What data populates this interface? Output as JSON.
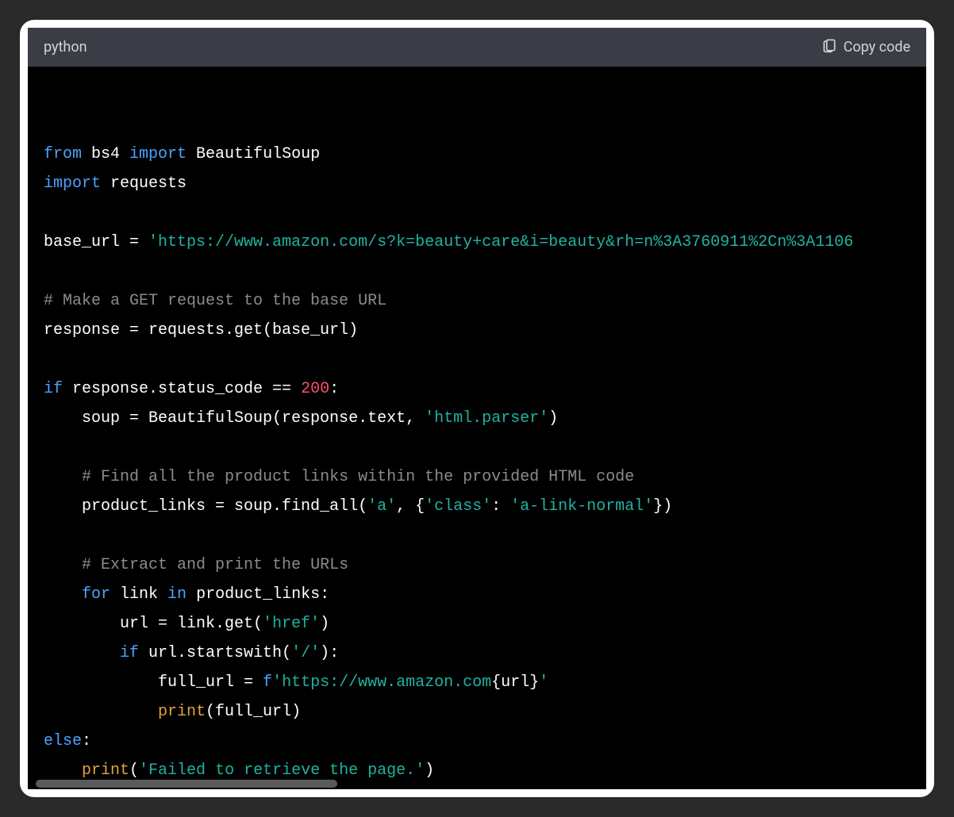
{
  "header": {
    "language": "python",
    "copy_label": "Copy code"
  },
  "code": {
    "tokens": [
      [
        [
          "kw",
          "from"
        ],
        [
          "id",
          " bs4 "
        ],
        [
          "kw",
          "import"
        ],
        [
          "id",
          " BeautifulSoup"
        ]
      ],
      [
        [
          "kw",
          "import"
        ],
        [
          "id",
          " requests"
        ]
      ],
      [],
      [
        [
          "id",
          "base_url = "
        ],
        [
          "str",
          "'https://www.amazon.com/s?k=beauty+care&i=beauty&rh=n%3A3760911%2Cn%3A1106"
        ]
      ],
      [],
      [
        [
          "com",
          "# Make a GET request to the base URL"
        ]
      ],
      [
        [
          "id",
          "response = requests.get(base_url)"
        ]
      ],
      [],
      [
        [
          "kw",
          "if"
        ],
        [
          "id",
          " response.status_code == "
        ],
        [
          "num",
          "200"
        ],
        [
          "id",
          ":"
        ]
      ],
      [
        [
          "id",
          "    soup = BeautifulSoup(response.text, "
        ],
        [
          "str",
          "'html.parser'"
        ],
        [
          "id",
          ")"
        ]
      ],
      [],
      [
        [
          "id",
          "    "
        ],
        [
          "com",
          "# Find all the product links within the provided HTML code"
        ]
      ],
      [
        [
          "id",
          "    product_links = soup.find_all("
        ],
        [
          "str",
          "'a'"
        ],
        [
          "id",
          ", {"
        ],
        [
          "str",
          "'class'"
        ],
        [
          "id",
          ": "
        ],
        [
          "str",
          "'a-link-normal'"
        ],
        [
          "id",
          "})"
        ]
      ],
      [],
      [
        [
          "id",
          "    "
        ],
        [
          "com",
          "# Extract and print the URLs"
        ]
      ],
      [
        [
          "id",
          "    "
        ],
        [
          "kw",
          "for"
        ],
        [
          "id",
          " link "
        ],
        [
          "kw",
          "in"
        ],
        [
          "id",
          " product_links:"
        ]
      ],
      [
        [
          "id",
          "        url = link.get("
        ],
        [
          "str",
          "'href'"
        ],
        [
          "id",
          ")"
        ]
      ],
      [
        [
          "id",
          "        "
        ],
        [
          "kw",
          "if"
        ],
        [
          "id",
          " url.startswith("
        ],
        [
          "str",
          "'/'"
        ],
        [
          "id",
          "):"
        ]
      ],
      [
        [
          "id",
          "            full_url = "
        ],
        [
          "fpre",
          "f"
        ],
        [
          "str",
          "'https://www.amazon.com"
        ],
        [
          "interp",
          "{url}"
        ],
        [
          "str",
          "'"
        ]
      ],
      [
        [
          "id",
          "            "
        ],
        [
          "fn",
          "print"
        ],
        [
          "id",
          "(full_url)"
        ]
      ],
      [
        [
          "kw",
          "else"
        ],
        [
          "id",
          ":"
        ]
      ],
      [
        [
          "id",
          "    "
        ],
        [
          "fn",
          "print"
        ],
        [
          "id",
          "("
        ],
        [
          "str",
          "'Failed to retrieve the page.'"
        ],
        [
          "id",
          ")"
        ]
      ]
    ]
  }
}
